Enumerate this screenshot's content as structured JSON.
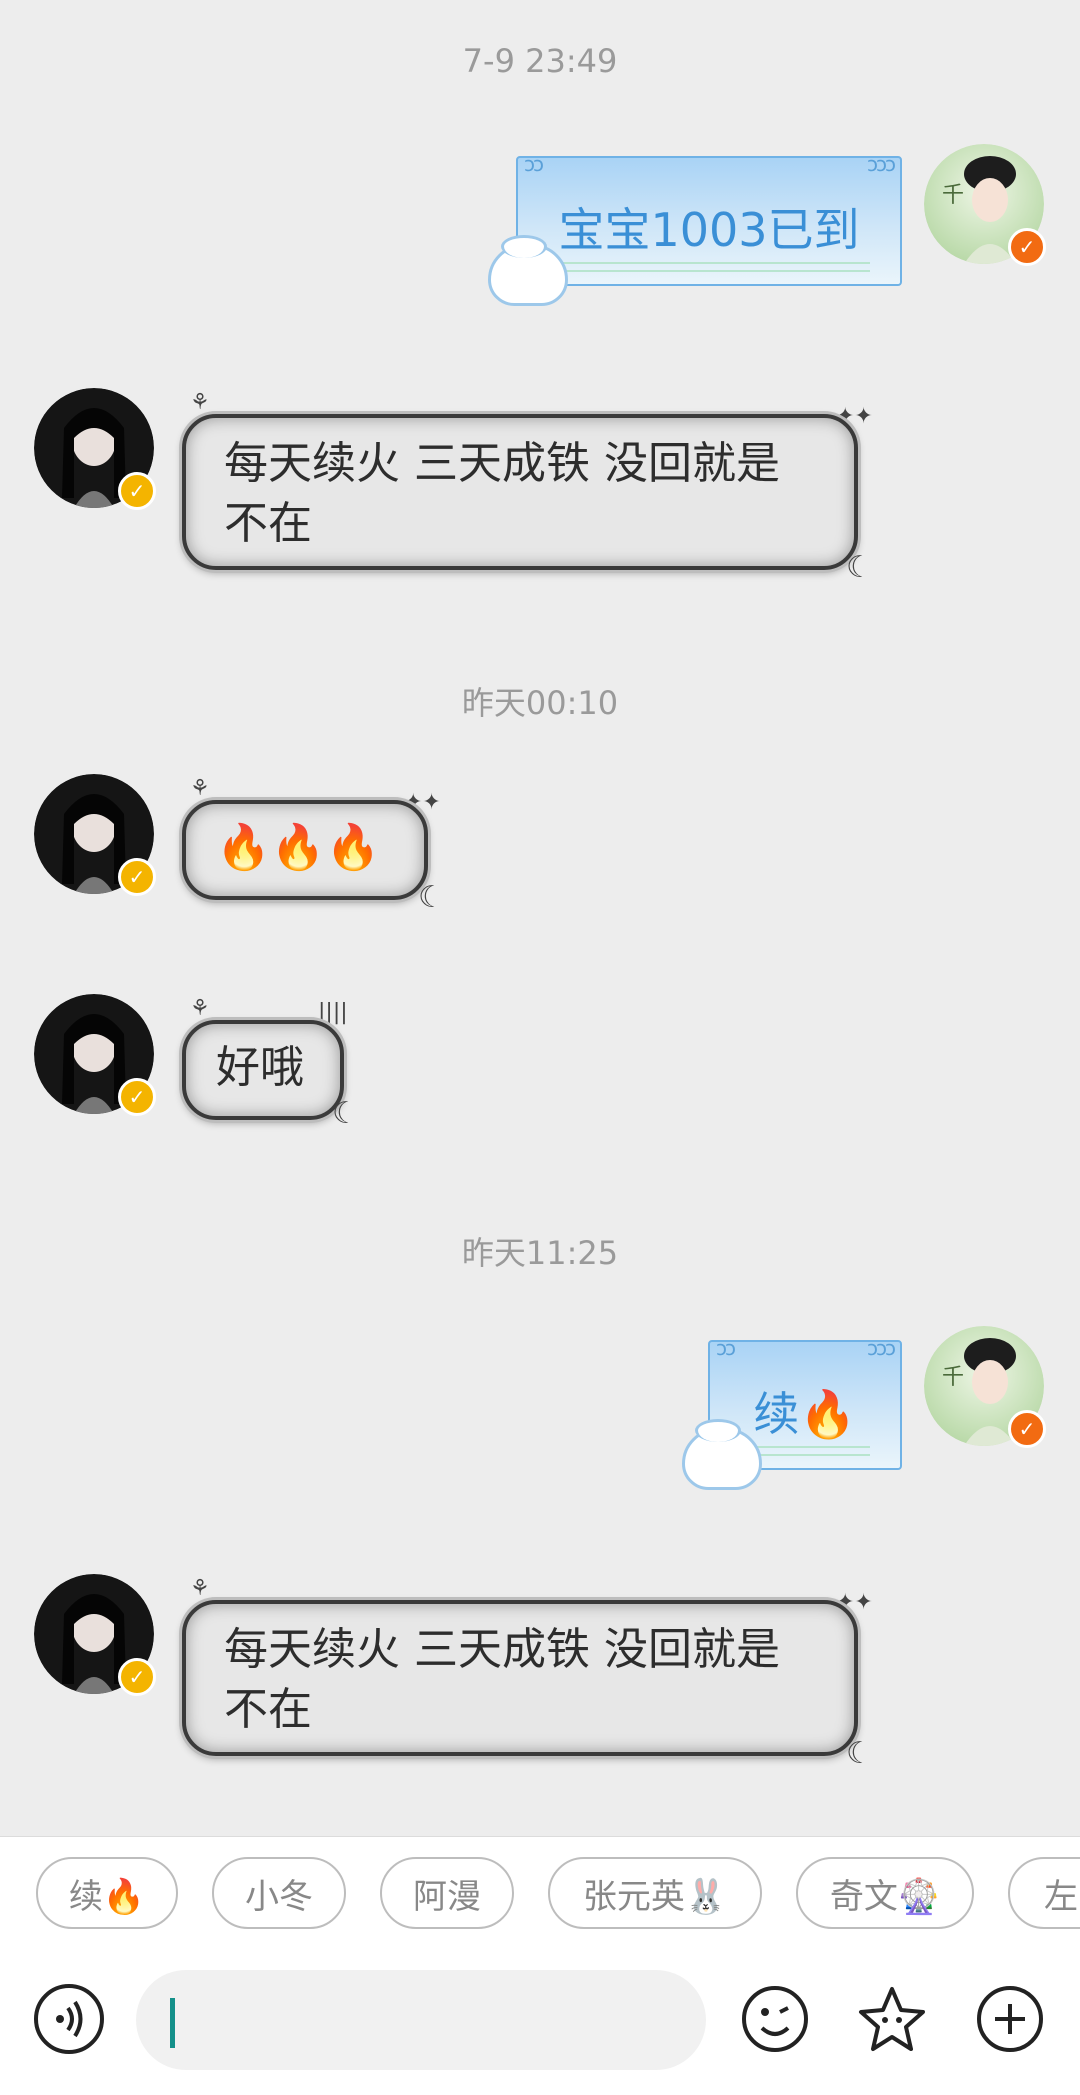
{
  "timestamps": [
    "7-9 23:49",
    "昨天00:10",
    "昨天11:25"
  ],
  "messages": [
    {
      "side": "right",
      "text": "宝宝1003已到"
    },
    {
      "side": "left",
      "line1": "每天续火 三天成铁 没回就是",
      "line2": "不在"
    },
    {
      "side": "left",
      "text": "🔥🔥🔥"
    },
    {
      "side": "left",
      "text": "好哦"
    },
    {
      "side": "right",
      "text": "续🔥"
    },
    {
      "side": "left",
      "line1": "每天续火 三天成铁 没回就是",
      "line2": "不在"
    }
  ],
  "quick_replies": [
    "续🔥",
    "小冬",
    "阿漫",
    "张元英🐰",
    "奇文🎡",
    "左"
  ],
  "input": {
    "value": ""
  },
  "colors": {
    "accent": "#14908a",
    "badge_left": "#f4b400",
    "badge_right": "#f26b12",
    "bubble_blue_text": "#3a8fd6"
  },
  "icons": [
    "voice-icon",
    "emoji-icon",
    "sticker-star-icon",
    "plus-icon",
    "verified-badge-icon",
    "fire-icon",
    "bunny-sticker-icon"
  ]
}
